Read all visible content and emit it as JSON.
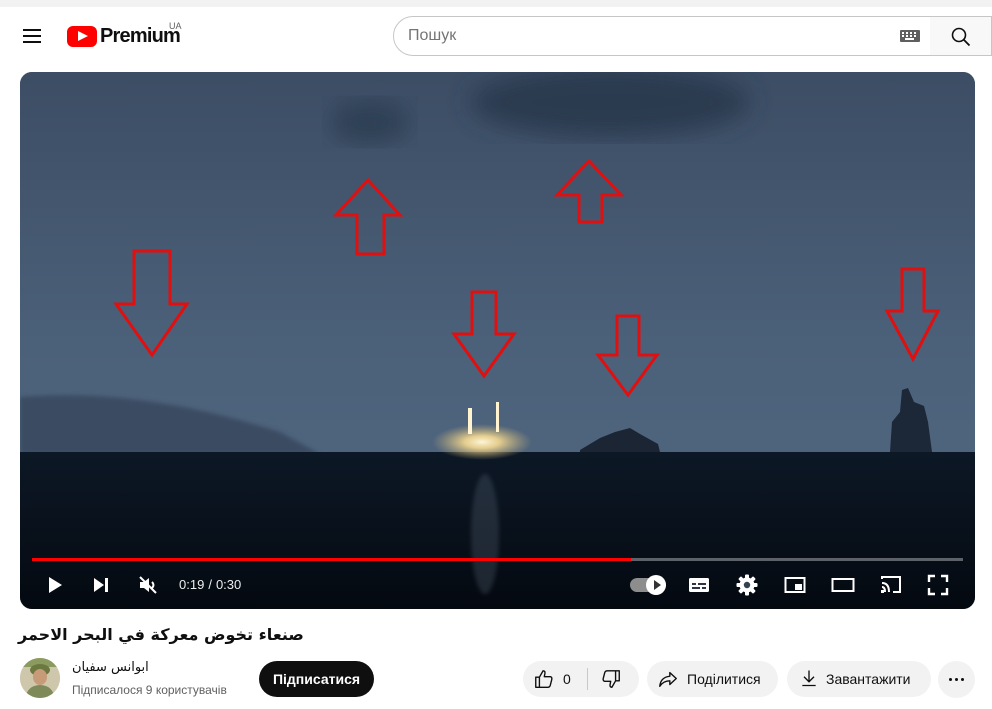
{
  "header": {
    "logo_text": "Premium",
    "region": "UA",
    "search_placeholder": "Пошук"
  },
  "player": {
    "current_time": "0:19",
    "separator": "/",
    "duration": "0:30",
    "progress_fraction": 0.643,
    "progress_color": "#ff0000",
    "autoplay_on": true,
    "controls": [
      "play-icon",
      "next-icon",
      "mute-icon",
      "autoplay-toggle",
      "subtitles-icon",
      "settings-icon",
      "miniplayer-icon",
      "theater-icon",
      "cast-icon",
      "fullscreen-icon"
    ]
  },
  "video": {
    "title": "صنعاء تخوض معركة في البحر الاحمر"
  },
  "channel": {
    "name": "ابوانس سفيان",
    "subscribers": "Підписалося 9 користувачів",
    "subscribe_label": "Підписатися"
  },
  "actions": {
    "like_count": "0",
    "share_label": "Поділитися",
    "download_label": "Завантажити"
  },
  "colors": {
    "brand_red": "#ff0000",
    "annotation_arrow": "#e01010"
  }
}
